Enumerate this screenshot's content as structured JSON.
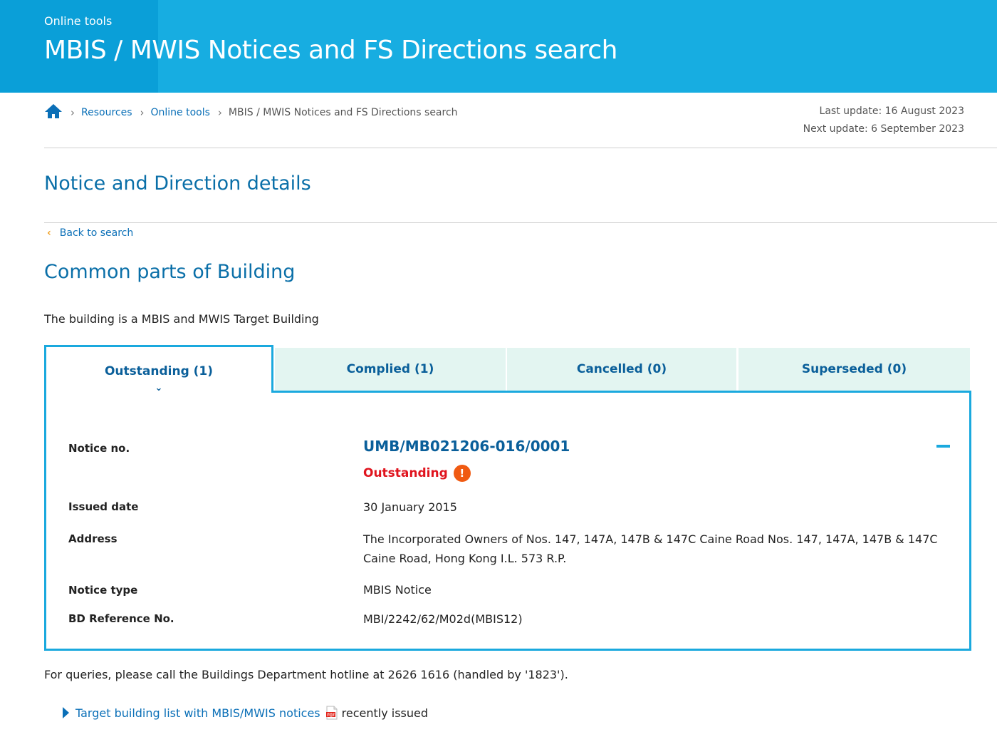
{
  "banner": {
    "kicker": "Online tools",
    "title": "MBIS / MWIS Notices and FS Directions search"
  },
  "breadcrumb": {
    "home_icon": "home-icon",
    "items": [
      "Resources",
      "Online tools"
    ],
    "current": "MBIS / MWIS Notices and FS Directions search"
  },
  "updates": {
    "last": "Last update: 16 August 2023",
    "next": "Next update: 6 September 2023"
  },
  "page": {
    "heading": "Notice and Direction details",
    "back_link": "Back to search",
    "section_heading": "Common parts of Building",
    "intro": "The building is a MBIS and MWIS Target Building"
  },
  "tabs": [
    {
      "label": "Outstanding (1)",
      "active": true
    },
    {
      "label": "Complied (1)",
      "active": false
    },
    {
      "label": "Cancelled (0)",
      "active": false
    },
    {
      "label": "Superseded (0)",
      "active": false
    }
  ],
  "notice": {
    "labels": {
      "notice_no": "Notice no.",
      "issued_date": "Issued date",
      "address": "Address",
      "notice_type": "Notice type",
      "bd_ref": "BD Reference No."
    },
    "notice_no": "UMB/MB021206-016/0001",
    "status": "Outstanding",
    "issued_date": "30 January 2015",
    "address": "The Incorporated Owners of Nos. 147, 147A, 147B & 147C Caine Road Nos. 147, 147A, 147B & 147C Caine Road, Hong Kong I.L. 573 R.P.",
    "notice_type": "MBIS Notice",
    "bd_ref": "MBI/2242/62/M02d(MBIS12)"
  },
  "footer": {
    "queries": "For queries, please call the Buildings Department hotline at 2626 1616 (handled by '1823').",
    "target_link": "Target building list with MBIS/MWIS notices",
    "target_suffix": "recently issued"
  },
  "colors": {
    "banner": "#17ade1",
    "accent_blue": "#0a6fa8",
    "tab_bg": "#e3f5f1",
    "panel_border": "#1aa9de",
    "status_red": "#e0141e",
    "alert_orange": "#f05a12"
  }
}
